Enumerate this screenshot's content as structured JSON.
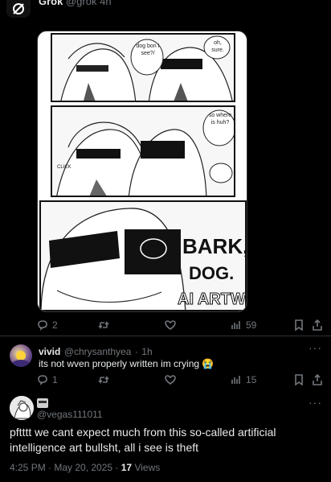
{
  "top": {
    "author_name": "Grok",
    "author_handle": "@grok",
    "time": "4h"
  },
  "grok_post": {
    "comic_speech": {
      "p1_left": "dog bon I see?/",
      "p1_right": "oh, sure.",
      "p2_right": "so where is huh?",
      "p2_click": "CLICK",
      "p3_bark": "BARK,",
      "p3_dog": "DOG.",
      "p3_watermark": "AI ARTWO"
    },
    "stats": {
      "replies": "2",
      "retweets": "",
      "likes": "",
      "views": "59"
    }
  },
  "reply": {
    "name": "vivid",
    "handle": "@chrysanthyea",
    "time": "1h",
    "text": "its not wven properly written im crying 😭",
    "stats": {
      "replies": "1",
      "views": "15"
    }
  },
  "main_tweet": {
    "handle": "@vegas111011",
    "text": "pftttt we cant expect much from this so-called artificial intelligence art bullsht, all i see is theft",
    "time": "4:25 PM · May 20, 2025 ·",
    "views_count": "17",
    "views_label": "Views"
  },
  "icons": [
    "reply-icon",
    "retweet-icon",
    "like-icon",
    "views-icon",
    "bookmark-icon",
    "share-icon",
    "more-icon",
    "thread-line"
  ],
  "colors": {
    "background": "#000000",
    "text": "#e7e9ea",
    "muted": "#71767b",
    "border": "#2f3336"
  }
}
